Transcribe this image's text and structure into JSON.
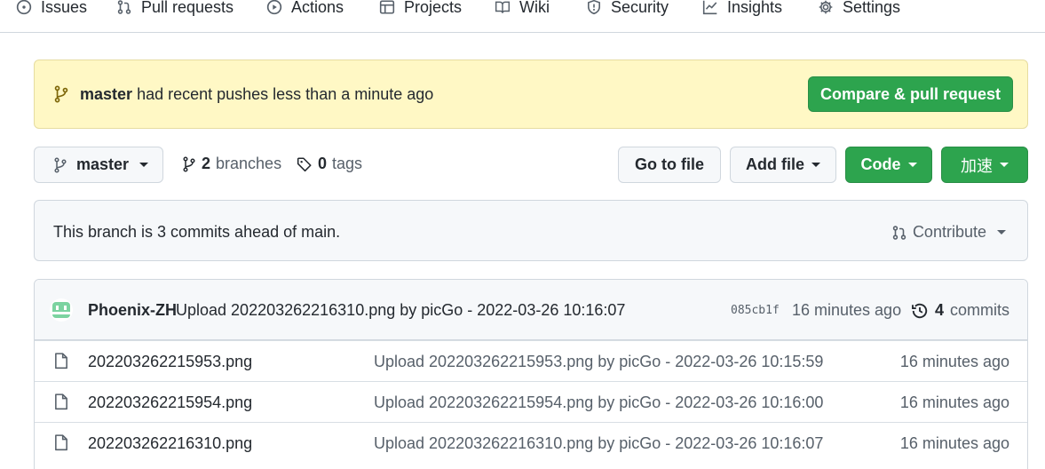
{
  "nav": {
    "items": [
      {
        "label": "Issues",
        "icon": "issue-icon"
      },
      {
        "label": "Pull requests",
        "icon": "pull-request-icon"
      },
      {
        "label": "Actions",
        "icon": "play-icon"
      },
      {
        "label": "Projects",
        "icon": "table-icon"
      },
      {
        "label": "Wiki",
        "icon": "book-icon"
      },
      {
        "label": "Security",
        "icon": "shield-icon"
      },
      {
        "label": "Insights",
        "icon": "graph-icon"
      },
      {
        "label": "Settings",
        "icon": "gear-icon"
      }
    ]
  },
  "banner": {
    "branch": "master",
    "text": "had recent pushes less than a minute ago",
    "button": "Compare & pull request"
  },
  "branchbar": {
    "branch": "master",
    "branches_count": "2",
    "branches_label": "branches",
    "tags_count": "0",
    "tags_label": "tags",
    "goto_file": "Go to file",
    "add_file": "Add file",
    "code": "Code",
    "speed": "加速"
  },
  "ahead": {
    "text": "This branch is 3 commits ahead of main.",
    "contribute": "Contribute"
  },
  "latest_commit": {
    "author": "Phoenix-ZH",
    "message": "Upload 202203262216310.png by picGo - 2022-03-26 10:16:07",
    "sha": "085cb1f",
    "time": "16 minutes ago",
    "commits_count": "4",
    "commits_label": "commits"
  },
  "files": [
    {
      "name": "202203262215953.png",
      "message": "Upload 202203262215953.png by picGo - 2022-03-26 10:15:59",
      "age": "16 minutes ago"
    },
    {
      "name": "202203262215954.png",
      "message": "Upload 202203262215954.png by picGo - 2022-03-26 10:16:00",
      "age": "16 minutes ago"
    },
    {
      "name": "202203262216310.png",
      "message": "Upload 202203262216310.png by picGo - 2022-03-26 10:16:07",
      "age": "16 minutes ago"
    }
  ],
  "colors": {
    "green": "#2da44e",
    "banner_bg": "#fff8c5",
    "border": "#d0d7de",
    "muted": "#57606a"
  }
}
